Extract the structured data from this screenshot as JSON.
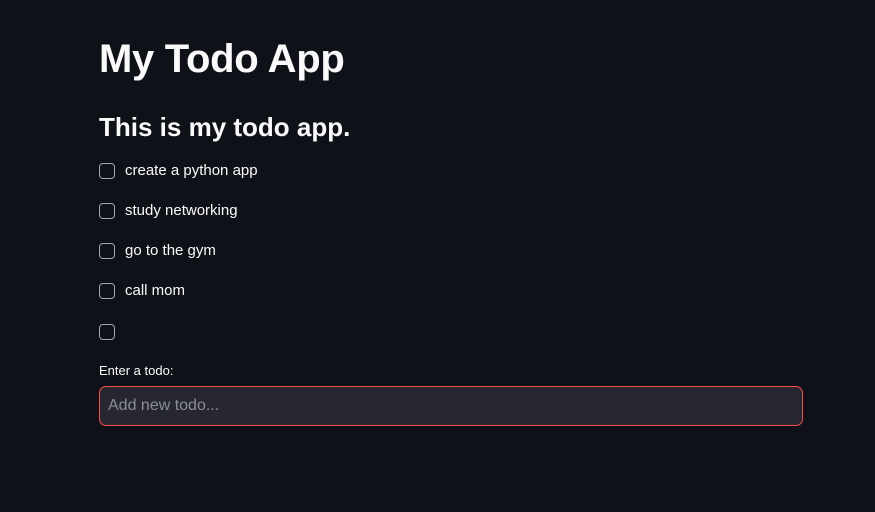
{
  "app": {
    "title": "My Todo App",
    "subtitle": "This is my todo app."
  },
  "todos": [
    {
      "label": "create a python app",
      "checked": false
    },
    {
      "label": "study networking",
      "checked": false
    },
    {
      "label": "go to the gym",
      "checked": false
    },
    {
      "label": "call mom",
      "checked": false
    },
    {
      "label": "",
      "checked": false
    }
  ],
  "new_todo": {
    "label": "Enter a todo:",
    "placeholder": "Add new todo...",
    "value": ""
  },
  "colors": {
    "background": "#0e1117",
    "text": "#fafafa",
    "input_background": "#262730",
    "input_focus_border": "#ff4b4b"
  }
}
